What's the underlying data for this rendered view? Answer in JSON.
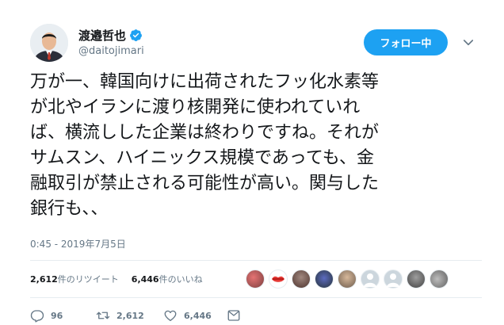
{
  "user": {
    "display_name": "渡邉哲也",
    "handle": "@daitojimari",
    "verified_icon": "verified-badge-icon"
  },
  "follow_button": {
    "label": "フォロー中"
  },
  "tweet": {
    "lines": [
      "万が一、韓国向けに出荷されたフッ化水素等",
      "が北やイランに渡り核開発に使われていれ",
      "ば、横流しした企業は終わりですね。それが",
      "サムスン、ハイニックス規模であっても、金",
      "融取引が禁止される可能性が高い。関与した",
      "銀行も、、"
    ],
    "timestamp": "0:45 - 2019年7月5日"
  },
  "stats": {
    "retweets_count": "2,612",
    "retweets_label": "件のリツイート",
    "likes_count": "6,446",
    "likes_label": "件のいいね"
  },
  "actions": {
    "reply_count": "96",
    "retweet_count": "2,612",
    "like_count": "6,446"
  },
  "colors": {
    "accent": "#1da1f2",
    "text": "#14171a",
    "secondary": "#657786",
    "divider": "#e6ecf0"
  }
}
